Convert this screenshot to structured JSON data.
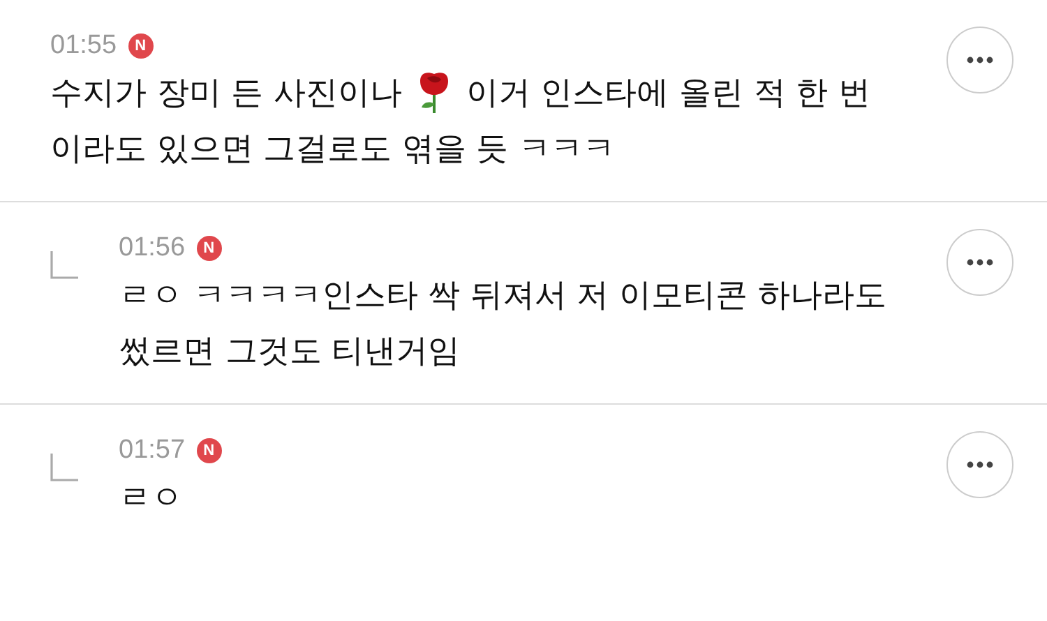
{
  "comment": {
    "time": "01:55",
    "badge": "N",
    "lines": [
      [
        {
          "kind": "text",
          "text": "수지가 장미 든 사진이나"
        },
        {
          "kind": "rose"
        },
        {
          "kind": "text",
          "text": "이거 인스타에 올린 적 한 번"
        }
      ],
      [
        {
          "kind": "text",
          "text": "이라도 있으면 그걸로도 엮을 듯 ㅋㅋㅋ"
        }
      ]
    ],
    "replies": [
      {
        "time": "01:56",
        "badge": "N",
        "lines": [
          [
            {
              "kind": "text",
              "text": "ㄹㅇ ㅋㅋㅋㅋ인스타 싹 뒤져서 저 이모티콘 하나라도"
            }
          ],
          [
            {
              "kind": "text",
              "text": "썼르면 그것도 티낸거임"
            }
          ]
        ]
      },
      {
        "time": "01:57",
        "badge": "N",
        "lines": [
          [
            {
              "kind": "text",
              "text": "ㄹㅇ"
            }
          ]
        ]
      }
    ]
  }
}
